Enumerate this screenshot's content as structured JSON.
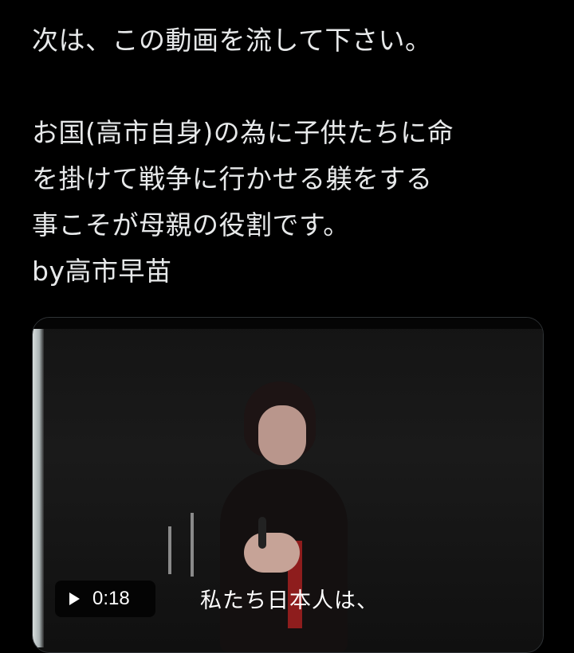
{
  "post": {
    "lines": [
      "次は、この動画を流して下さい。",
      "",
      "お国(高市自身)の為に子供たちに命",
      "を掛けて戦争に行かせる躾をする",
      "事こそが母親の役割です。",
      "by高市早苗"
    ]
  },
  "video": {
    "duration": "0:18",
    "subtitle": "私たち日本人は、",
    "play_icon": "play-icon"
  }
}
